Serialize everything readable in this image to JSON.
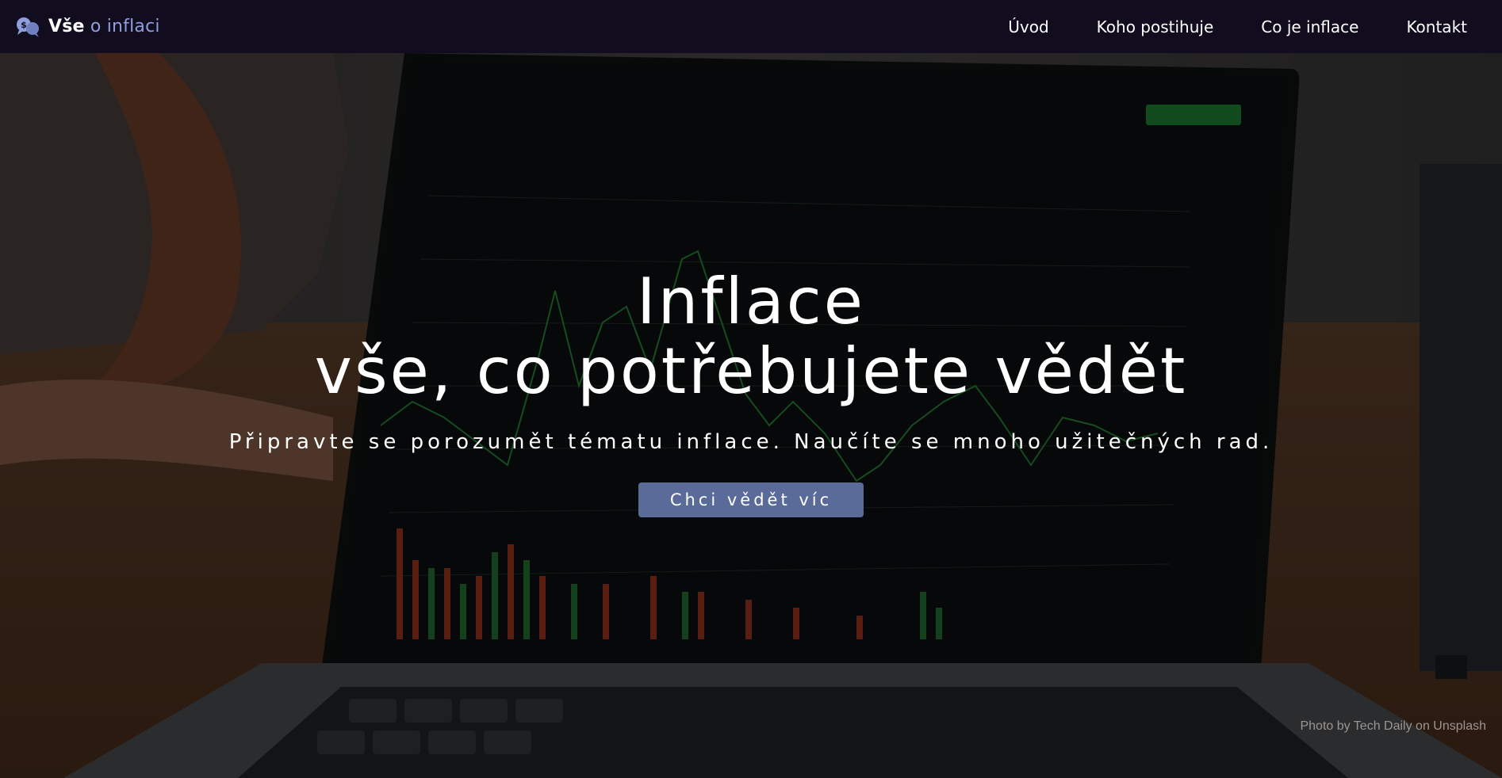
{
  "brand": {
    "name_strong": "Vše",
    "name_rest": " o inflaci",
    "icon": "chat-money-icon"
  },
  "nav": {
    "items": [
      {
        "label": "Úvod"
      },
      {
        "label": "Koho postihuje"
      },
      {
        "label": "Co je inflace"
      },
      {
        "label": "Kontakt"
      }
    ]
  },
  "hero": {
    "title_line1": "Inflace",
    "title_line2": "vše, co potřebujete vědět",
    "subtitle": "Připravte se porozumět tématu inflace. Naučíte se mnoho užitečných rad.",
    "cta_label": "Chci vědět víc",
    "photo_credit": "Photo by Tech Daily on Unsplash",
    "background_icon": "laptop-stock-chart-photo"
  },
  "colors": {
    "navbar_bg": "#110d1f",
    "brand_accent": "#8f9fdc",
    "cta_bg": "#5a6a99"
  }
}
